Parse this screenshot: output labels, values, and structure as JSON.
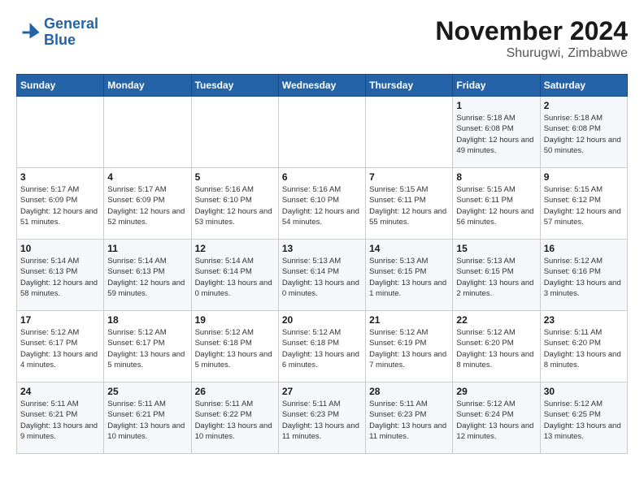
{
  "header": {
    "logo_line1": "General",
    "logo_line2": "Blue",
    "month_title": "November 2024",
    "subtitle": "Shurugwi, Zimbabwe"
  },
  "weekdays": [
    "Sunday",
    "Monday",
    "Tuesday",
    "Wednesday",
    "Thursday",
    "Friday",
    "Saturday"
  ],
  "weeks": [
    [
      {
        "day": "",
        "text": ""
      },
      {
        "day": "",
        "text": ""
      },
      {
        "day": "",
        "text": ""
      },
      {
        "day": "",
        "text": ""
      },
      {
        "day": "",
        "text": ""
      },
      {
        "day": "1",
        "text": "Sunrise: 5:18 AM\nSunset: 6:08 PM\nDaylight: 12 hours and 49 minutes."
      },
      {
        "day": "2",
        "text": "Sunrise: 5:18 AM\nSunset: 6:08 PM\nDaylight: 12 hours and 50 minutes."
      }
    ],
    [
      {
        "day": "3",
        "text": "Sunrise: 5:17 AM\nSunset: 6:09 PM\nDaylight: 12 hours and 51 minutes."
      },
      {
        "day": "4",
        "text": "Sunrise: 5:17 AM\nSunset: 6:09 PM\nDaylight: 12 hours and 52 minutes."
      },
      {
        "day": "5",
        "text": "Sunrise: 5:16 AM\nSunset: 6:10 PM\nDaylight: 12 hours and 53 minutes."
      },
      {
        "day": "6",
        "text": "Sunrise: 5:16 AM\nSunset: 6:10 PM\nDaylight: 12 hours and 54 minutes."
      },
      {
        "day": "7",
        "text": "Sunrise: 5:15 AM\nSunset: 6:11 PM\nDaylight: 12 hours and 55 minutes."
      },
      {
        "day": "8",
        "text": "Sunrise: 5:15 AM\nSunset: 6:11 PM\nDaylight: 12 hours and 56 minutes."
      },
      {
        "day": "9",
        "text": "Sunrise: 5:15 AM\nSunset: 6:12 PM\nDaylight: 12 hours and 57 minutes."
      }
    ],
    [
      {
        "day": "10",
        "text": "Sunrise: 5:14 AM\nSunset: 6:13 PM\nDaylight: 12 hours and 58 minutes."
      },
      {
        "day": "11",
        "text": "Sunrise: 5:14 AM\nSunset: 6:13 PM\nDaylight: 12 hours and 59 minutes."
      },
      {
        "day": "12",
        "text": "Sunrise: 5:14 AM\nSunset: 6:14 PM\nDaylight: 13 hours and 0 minutes."
      },
      {
        "day": "13",
        "text": "Sunrise: 5:13 AM\nSunset: 6:14 PM\nDaylight: 13 hours and 0 minutes."
      },
      {
        "day": "14",
        "text": "Sunrise: 5:13 AM\nSunset: 6:15 PM\nDaylight: 13 hours and 1 minute."
      },
      {
        "day": "15",
        "text": "Sunrise: 5:13 AM\nSunset: 6:15 PM\nDaylight: 13 hours and 2 minutes."
      },
      {
        "day": "16",
        "text": "Sunrise: 5:12 AM\nSunset: 6:16 PM\nDaylight: 13 hours and 3 minutes."
      }
    ],
    [
      {
        "day": "17",
        "text": "Sunrise: 5:12 AM\nSunset: 6:17 PM\nDaylight: 13 hours and 4 minutes."
      },
      {
        "day": "18",
        "text": "Sunrise: 5:12 AM\nSunset: 6:17 PM\nDaylight: 13 hours and 5 minutes."
      },
      {
        "day": "19",
        "text": "Sunrise: 5:12 AM\nSunset: 6:18 PM\nDaylight: 13 hours and 5 minutes."
      },
      {
        "day": "20",
        "text": "Sunrise: 5:12 AM\nSunset: 6:18 PM\nDaylight: 13 hours and 6 minutes."
      },
      {
        "day": "21",
        "text": "Sunrise: 5:12 AM\nSunset: 6:19 PM\nDaylight: 13 hours and 7 minutes."
      },
      {
        "day": "22",
        "text": "Sunrise: 5:12 AM\nSunset: 6:20 PM\nDaylight: 13 hours and 8 minutes."
      },
      {
        "day": "23",
        "text": "Sunrise: 5:11 AM\nSunset: 6:20 PM\nDaylight: 13 hours and 8 minutes."
      }
    ],
    [
      {
        "day": "24",
        "text": "Sunrise: 5:11 AM\nSunset: 6:21 PM\nDaylight: 13 hours and 9 minutes."
      },
      {
        "day": "25",
        "text": "Sunrise: 5:11 AM\nSunset: 6:21 PM\nDaylight: 13 hours and 10 minutes."
      },
      {
        "day": "26",
        "text": "Sunrise: 5:11 AM\nSunset: 6:22 PM\nDaylight: 13 hours and 10 minutes."
      },
      {
        "day": "27",
        "text": "Sunrise: 5:11 AM\nSunset: 6:23 PM\nDaylight: 13 hours and 11 minutes."
      },
      {
        "day": "28",
        "text": "Sunrise: 5:11 AM\nSunset: 6:23 PM\nDaylight: 13 hours and 11 minutes."
      },
      {
        "day": "29",
        "text": "Sunrise: 5:12 AM\nSunset: 6:24 PM\nDaylight: 13 hours and 12 minutes."
      },
      {
        "day": "30",
        "text": "Sunrise: 5:12 AM\nSunset: 6:25 PM\nDaylight: 13 hours and 13 minutes."
      }
    ]
  ]
}
